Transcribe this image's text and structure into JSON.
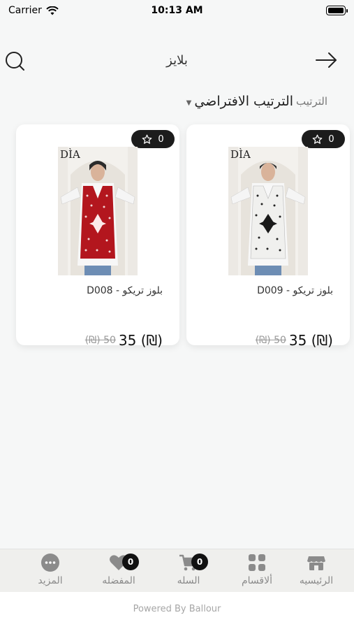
{
  "status_bar": {
    "carrier": "Carrier",
    "time": "10:13 AM"
  },
  "header": {
    "title": "بلايز"
  },
  "sort": {
    "label": "الترتيب",
    "value": "الترتيب الافتراضي"
  },
  "products": [
    {
      "name": "بلوز تريكو - D009",
      "rating": "0",
      "price": "35 (₪)",
      "old_price": "(₪) 50",
      "brand": "DÌA"
    },
    {
      "name": "بلوز تريكو - D008",
      "rating": "0",
      "price": "35 (₪)",
      "old_price": "(₪) 50",
      "brand": "DÌA"
    }
  ],
  "nav": {
    "home": "الرئيسيه",
    "categories": "ألاقسام",
    "cart": "السله",
    "favorites": "المفضله",
    "more": "المزيد",
    "cart_count": "0",
    "favorites_count": "0"
  },
  "footer": {
    "text": "Powered By Ballour"
  },
  "colors": {
    "badge_bg": "#1c1c1c",
    "nav_icon": "#8b8b8b",
    "background": "#f6f7f7"
  }
}
